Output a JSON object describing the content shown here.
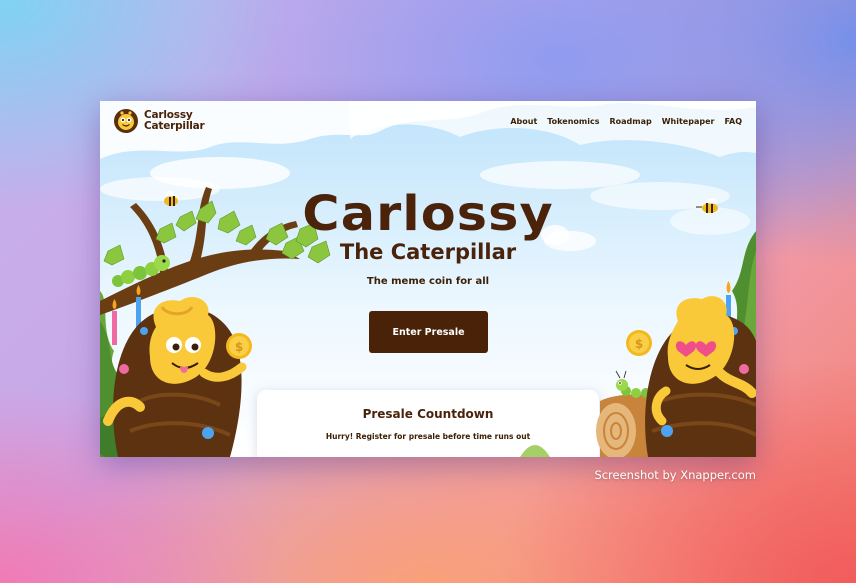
{
  "header": {
    "logo_line1": "Carlossy",
    "logo_line2": "Caterpillar",
    "nav": [
      "About",
      "Tokenomics",
      "Roadmap",
      "Whitepaper",
      "FAQ"
    ]
  },
  "hero": {
    "title": "Carlossy",
    "subtitle": "The Caterpillar",
    "tagline": "The meme coin for all",
    "cta_label": "Enter Presale"
  },
  "countdown": {
    "title": "Presale Countdown",
    "text": "Hurry! Register for presale before time runs out"
  },
  "credit": "Screenshot by Xnapper.com",
  "colors": {
    "brand_brown": "#4a2208",
    "sky": "#bfe3fb",
    "mascot_yellow": "#f9c93a",
    "leaf_green": "#8cc63f"
  },
  "icons": [
    "caterpillar-logo-icon",
    "coin-icon",
    "bee-icon",
    "candle-icon",
    "heart-eyes-icon"
  ]
}
